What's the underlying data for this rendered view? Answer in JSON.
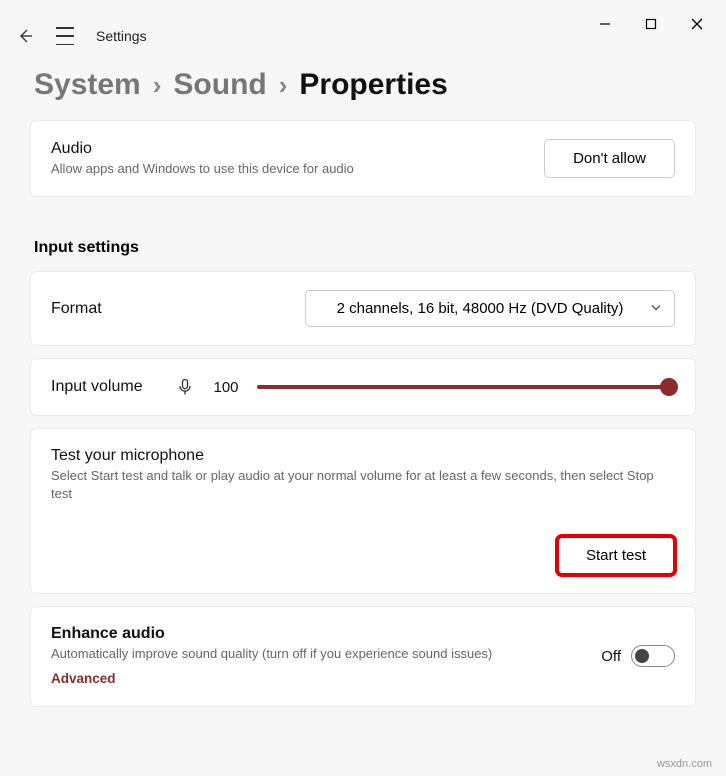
{
  "window": {
    "app_title": "Settings"
  },
  "breadcrumb": {
    "system": "System",
    "sound": "Sound",
    "properties": "Properties"
  },
  "audio_card": {
    "title": "Audio",
    "subtitle": "Allow apps and Windows to use this device for audio",
    "button": "Don't allow"
  },
  "input_section_heading": "Input settings",
  "format_row": {
    "label": "Format",
    "value": "2 channels, 16 bit, 48000 Hz (DVD Quality)"
  },
  "volume_row": {
    "label": "Input volume",
    "value": "100"
  },
  "test_card": {
    "title": "Test your microphone",
    "subtitle": "Select Start test and talk or play audio at your normal volume for at least a few seconds, then select Stop test",
    "button": "Start test"
  },
  "enhance_card": {
    "title": "Enhance audio",
    "subtitle": "Automatically improve sound quality (turn off if you experience sound issues)",
    "advanced": "Advanced",
    "toggle_label": "Off"
  },
  "watermark": "wsxdn.com"
}
